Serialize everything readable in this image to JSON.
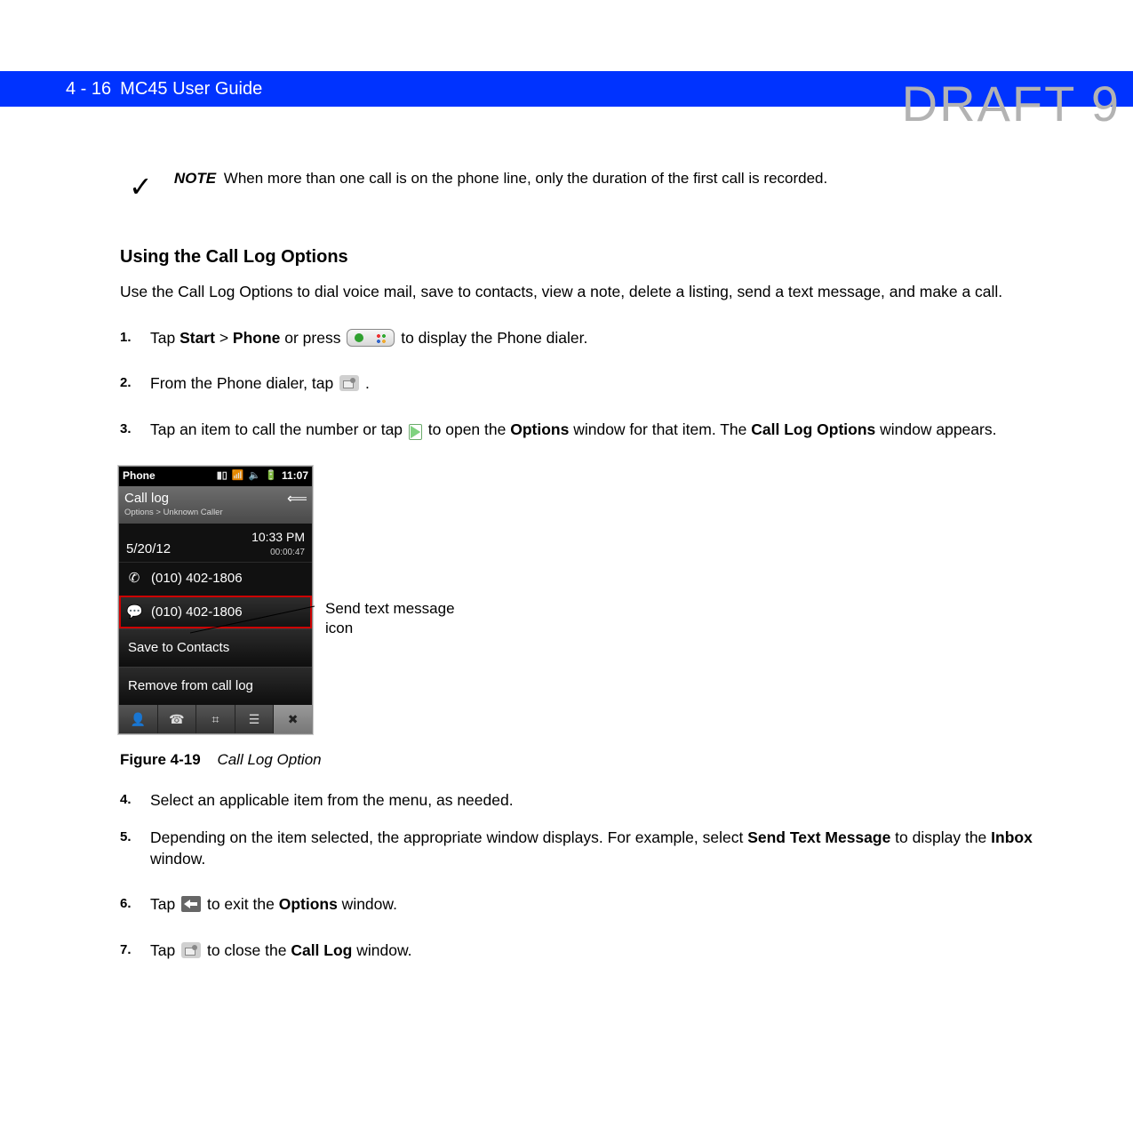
{
  "watermark": "DRAFT 9",
  "header": {
    "page": "4 - 16",
    "title": "MC45 User Guide"
  },
  "note": {
    "label": "NOTE",
    "text": "When more than one call is on the phone line, only the duration of the first call is recorded."
  },
  "section_title": "Using the Call Log Options",
  "lead": "Use the Call Log Options to dial voice mail, save to contacts, view a note, delete a listing, send a text message, and make a call.",
  "steps": {
    "s1a": "Tap ",
    "s1_start": "Start",
    "s1_gt": " > ",
    "s1_phone": "Phone",
    "s1b": " or press ",
    "s1c": " to display the Phone dialer.",
    "s2a": "From the Phone dialer, tap ",
    "s2b": ".",
    "s3a": "Tap an item to call the number or tap ",
    "s3b": " to open the ",
    "s3_opt": "Options",
    "s3c": " window for that item. The ",
    "s3_clo": "Call Log Options",
    "s3d": " window appears.",
    "s4": "Select an applicable item from the menu, as needed.",
    "s5a": "Depending on the item selected, the appropriate window displays. For example, select ",
    "s5_stm": "Send Text Message",
    "s5b": " to display the ",
    "s5_inbox": "Inbox",
    "s5c": " window.",
    "s6a": "Tap ",
    "s6b": " to exit the ",
    "s6_opt": "Options",
    "s6c": " window.",
    "s7a": "Tap ",
    "s7b": " to close the ",
    "s7_cl": "Call Log",
    "s7c": " window."
  },
  "nums": {
    "n1": "1.",
    "n2": "2.",
    "n3": "3.",
    "n4": "4.",
    "n5": "5.",
    "n6": "6.",
    "n7": "7."
  },
  "callout": {
    "line1": "Send text message",
    "line2": "icon"
  },
  "figure": {
    "num": "Figure 4-19",
    "title": "Call Log Option"
  },
  "phone": {
    "status_left": "Phone",
    "status_time": "11:07",
    "title": "Call log",
    "subtitle": "Options > Unknown Caller",
    "date": "5/20/12",
    "time": "10:33 PM",
    "duration": "00:00:47",
    "entry1": "(010) 402-1806",
    "entry2": "(010) 402-1806",
    "menu1": "Save to Contacts",
    "menu2": "Remove from call log"
  }
}
